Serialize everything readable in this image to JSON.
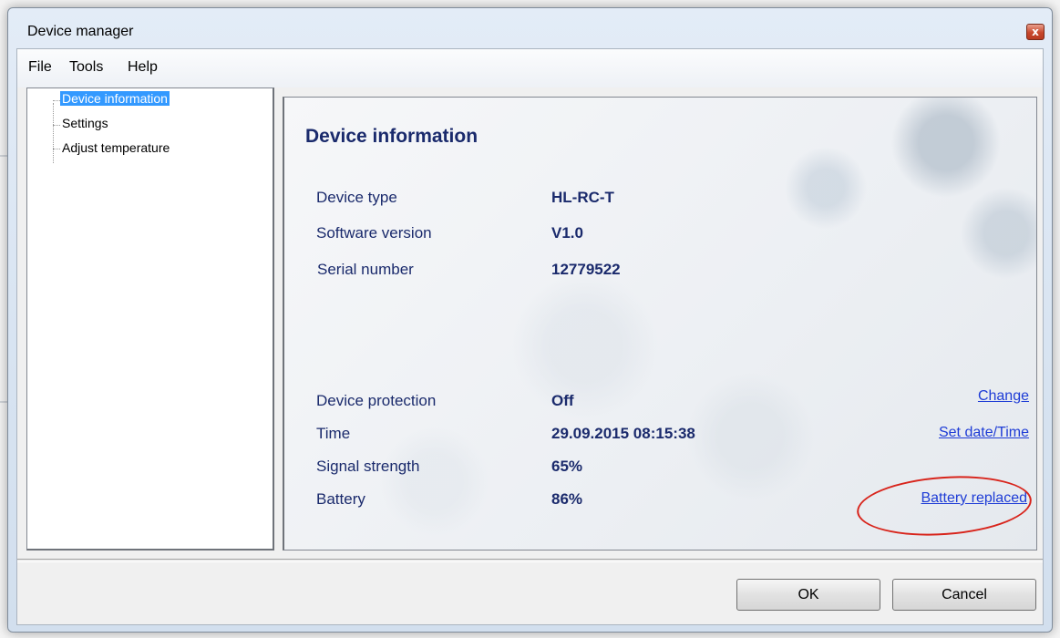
{
  "window": {
    "title": "Device manager",
    "close_glyph": "x"
  },
  "menu": {
    "items": [
      "File",
      "Tools",
      "Help"
    ]
  },
  "tree": {
    "items": [
      "Device information",
      "Settings",
      "Adjust temperature"
    ]
  },
  "content": {
    "heading": "Device information",
    "info": [
      {
        "label": "Device type",
        "value": "HL-RC-T"
      },
      {
        "label": "Software version",
        "value": "V1.0"
      },
      {
        "label": "Serial number",
        "value": "12779522"
      }
    ],
    "status": [
      {
        "label": "Device protection",
        "value": "Off",
        "link": "Change"
      },
      {
        "label": "Time",
        "value": "29.09.2015 08:15:38",
        "link": "Set date/Time"
      },
      {
        "label": "Signal strength",
        "value": "65%",
        "link": ""
      },
      {
        "label": "Battery",
        "value": "86%",
        "link": "Battery replaced"
      }
    ]
  },
  "buttons": {
    "ok": "OK",
    "cancel": "Cancel"
  },
  "colors": {
    "text_navy": "#1a2a6c",
    "link_blue": "#1e3cd6",
    "highlight_red": "#d8241b",
    "selection_blue": "#3399ff"
  }
}
